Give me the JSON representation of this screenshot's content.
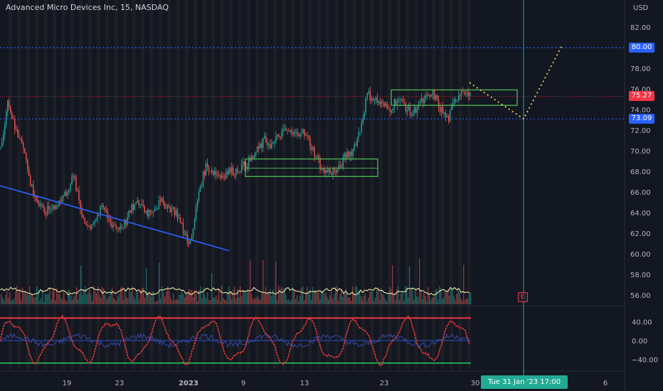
{
  "header": {
    "title": "Advanced Micro Devices Inc, 15, NASDAQ"
  },
  "price_axis": {
    "currency": "USD",
    "ticks": [
      "82.00",
      "80.00",
      "78.00",
      "76.00",
      "74.00",
      "72.00",
      "70.00",
      "68.00",
      "66.00",
      "64.00",
      "62.00",
      "60.00",
      "58.00",
      "56.00"
    ]
  },
  "tags": {
    "level_upper": "80.00",
    "last_price": "75.27",
    "level_lower": "73.09"
  },
  "oscillator_axis": {
    "ticks": [
      "40.00",
      "0.00",
      "−40.00"
    ]
  },
  "time_axis": {
    "ticks": [
      "19",
      "23",
      "2023",
      "9",
      "13",
      "23",
      "30",
      "6"
    ],
    "crosshair_label": "Tue 31 Jan '23   17:00"
  },
  "earnings_marker": "E",
  "colors": {
    "background": "#131722",
    "bull": "#26a69a",
    "bear": "#ef5350",
    "trendline": "#2962ff",
    "box": "#4caf50",
    "projection": "#f5d142",
    "level": "#2962ff",
    "last_price": "#f23645",
    "crosshair_label": "#22ab94"
  },
  "chart_data": {
    "type": "candlestick",
    "title": "Advanced Micro Devices Inc, 15, NASDAQ",
    "ylabel": "USD",
    "ylim": [
      55,
      83
    ],
    "categories": [
      "19",
      "23",
      "2023",
      "9",
      "13",
      "23",
      "30",
      "6"
    ],
    "series": [
      {
        "name": "",
        "values": [
          70,
          75,
          72,
          71,
          67,
          65,
          64,
          64.5,
          65,
          66,
          67.5,
          64,
          62.5,
          63.5,
          64.5,
          63,
          62.5,
          63,
          64.5,
          65,
          64,
          64.5,
          65,
          64.5,
          64,
          62,
          61,
          66,
          68.5,
          68,
          67.5,
          68,
          68,
          68.5,
          69,
          70,
          71,
          70.5,
          71.5,
          72,
          71.5,
          72,
          71,
          69.5,
          68,
          68,
          68,
          69.5,
          70,
          72,
          75.5,
          75,
          74.5,
          74,
          75,
          74.5,
          73.5,
          74.5,
          75,
          75.5,
          74,
          73,
          75,
          76,
          75.27
        ]
      }
    ],
    "levels": [
      80.0,
      75.27,
      73.09
    ],
    "oscillator": {
      "ylim": [
        -60,
        60
      ],
      "upper_band": 48,
      "lower_band": -48,
      "zero": 0
    }
  }
}
